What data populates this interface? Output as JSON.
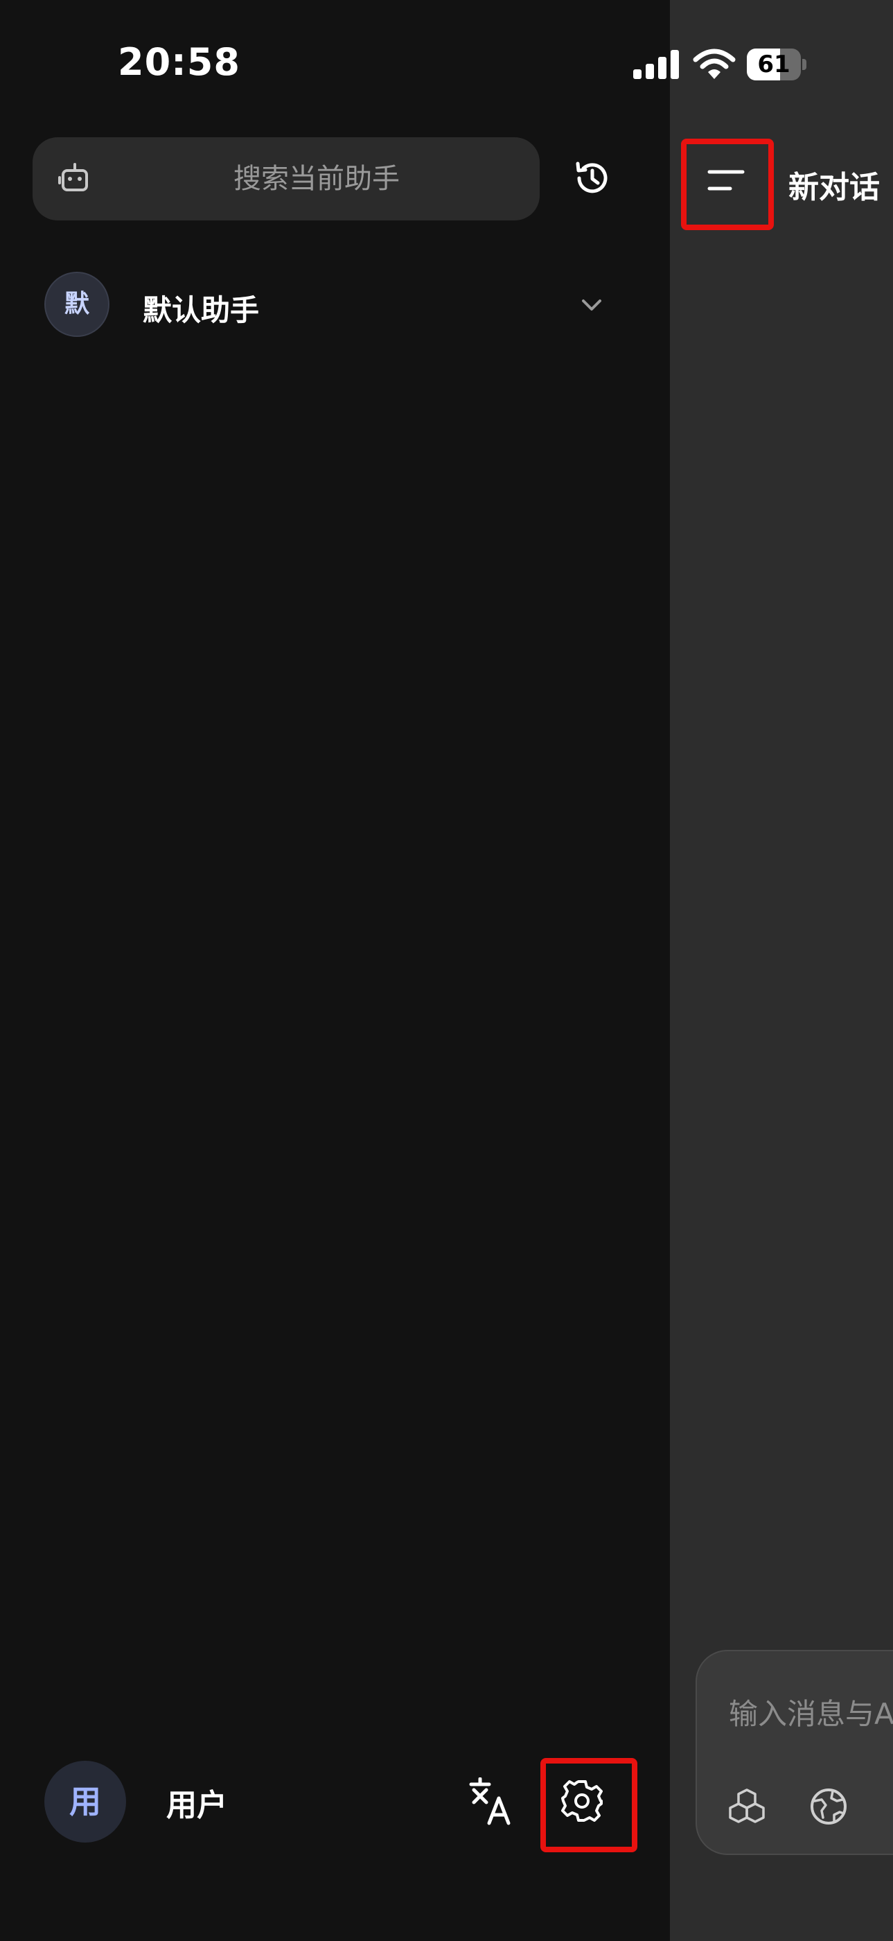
{
  "status_bar": {
    "time": "20:58",
    "battery_percent": "61",
    "battery_level": 0.61
  },
  "drawer": {
    "search": {
      "placeholder": "搜索当前助手"
    },
    "assistants": [
      {
        "avatar_text": "默",
        "name": "默认助手"
      }
    ],
    "user": {
      "avatar_text": "用",
      "name": "用户"
    }
  },
  "main": {
    "title": "新对话",
    "composer": {
      "placeholder": "输入消息与AI助手交流"
    }
  },
  "icons": {
    "search_prefix": "robot-icon",
    "history": "history-icon",
    "expand": "chevron-down-icon",
    "translate": "translate-icon",
    "settings": "gear-icon",
    "menu": "menu-icon",
    "tools": [
      "cubes-icon",
      "globe-icon"
    ]
  },
  "colors": {
    "highlight": "#e8120f",
    "drawer_bg": "#121212",
    "main_bg": "#2d2d2d"
  }
}
